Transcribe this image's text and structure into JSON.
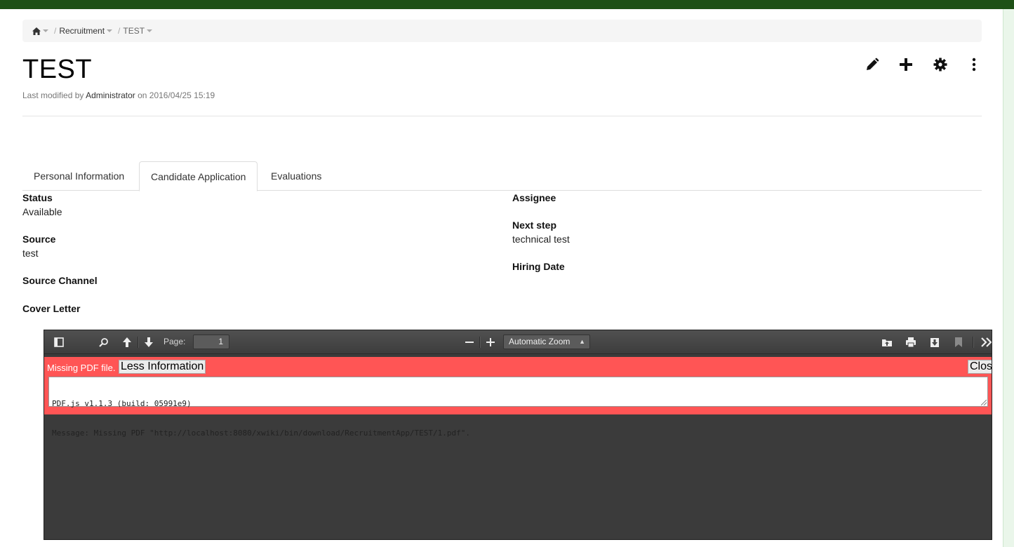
{
  "colors": {
    "topbar": "#1e5116",
    "error": "#ff5555",
    "viewer_bg": "#3b3b3b"
  },
  "breadcrumb": {
    "home_icon": "home-icon",
    "items": [
      "Recruitment",
      "TEST"
    ]
  },
  "page": {
    "title": "TEST",
    "meta_prefix": "Last modified by",
    "meta_user": "Administrator",
    "meta_suffix": "on 2016/04/25 15:19"
  },
  "actions": [
    "edit-icon",
    "add-icon",
    "gear-icon",
    "more-icon"
  ],
  "tabs": [
    {
      "label": "Personal Information",
      "active": false
    },
    {
      "label": "Candidate Application",
      "active": true
    },
    {
      "label": "Evaluations",
      "active": false
    }
  ],
  "fields": {
    "status": {
      "label": "Status",
      "value": "Available"
    },
    "source": {
      "label": "Source",
      "value": "test"
    },
    "source_channel": {
      "label": "Source Channel",
      "value": ""
    },
    "cover_letter": {
      "label": "Cover Letter",
      "value": ""
    },
    "assignee": {
      "label": "Assignee",
      "value": ""
    },
    "next_step": {
      "label": "Next step",
      "value": "technical test"
    },
    "hiring_date": {
      "label": "Hiring Date",
      "value": ""
    }
  },
  "viewer": {
    "page_label": "Page:",
    "page_value": "1",
    "zoom": "Automatic Zoom",
    "error_message": "Missing PDF file.",
    "less_info_button": "Less Information",
    "close_button": "Close",
    "error_line1": "PDF.js v1.1.3 (build: 05991e9)",
    "error_line2": "Message: Missing PDF \"http://localhost:8080/xwiki/bin/download/RecruitmentApp/TEST/1.pdf\"."
  }
}
